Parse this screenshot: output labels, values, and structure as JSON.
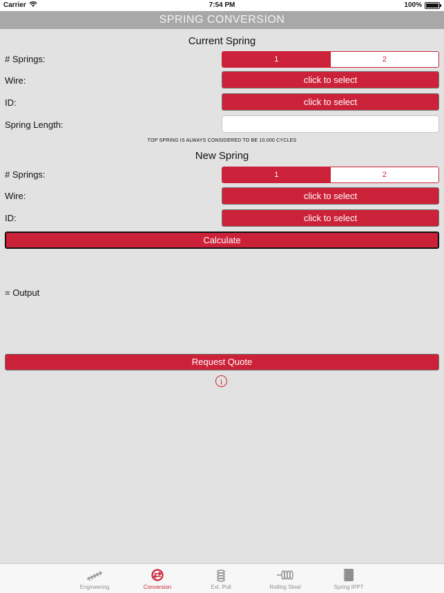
{
  "status_bar": {
    "carrier": "Carrier",
    "time": "7:54 PM",
    "battery": "100%"
  },
  "title": "SPRING CONVERSION",
  "current_spring": {
    "heading": "Current Spring",
    "springs_label": "# Springs:",
    "springs_options": [
      "1",
      "2"
    ],
    "springs_selected": "1",
    "wire_label": "Wire:",
    "wire_button": "click to select",
    "id_label": "ID:",
    "id_button": "click to select",
    "length_label": "Spring Length:",
    "length_value": ""
  },
  "note": "TOP SPRING IS ALWAYS CONSIDERED TO BE 10,000 CYCLES",
  "new_spring": {
    "heading": "New Spring",
    "springs_label": "# Springs:",
    "springs_options": [
      "1",
      "2"
    ],
    "springs_selected": "1",
    "wire_label": "Wire:",
    "wire_button": "click to select",
    "id_label": "ID:",
    "id_button": "click to select"
  },
  "calculate_label": "Calculate",
  "output_label": "= Output",
  "request_quote_label": "Request Quote",
  "info_icon": "i",
  "tabs": [
    {
      "label": "Engineering",
      "icon": "spring-icon",
      "active": false
    },
    {
      "label": "Conversion",
      "icon": "conversion-icon",
      "active": true
    },
    {
      "label": "Ext. Pull",
      "icon": "extension-spring-icon",
      "active": false
    },
    {
      "label": "Rolling Steel",
      "icon": "coil-icon",
      "active": false
    },
    {
      "label": "Spring IPPT",
      "icon": "notebook-icon",
      "active": false
    }
  ],
  "colors": {
    "accent": "#cc2239",
    "background": "#e2e2e2",
    "titlebar": "#a8a8a8"
  }
}
